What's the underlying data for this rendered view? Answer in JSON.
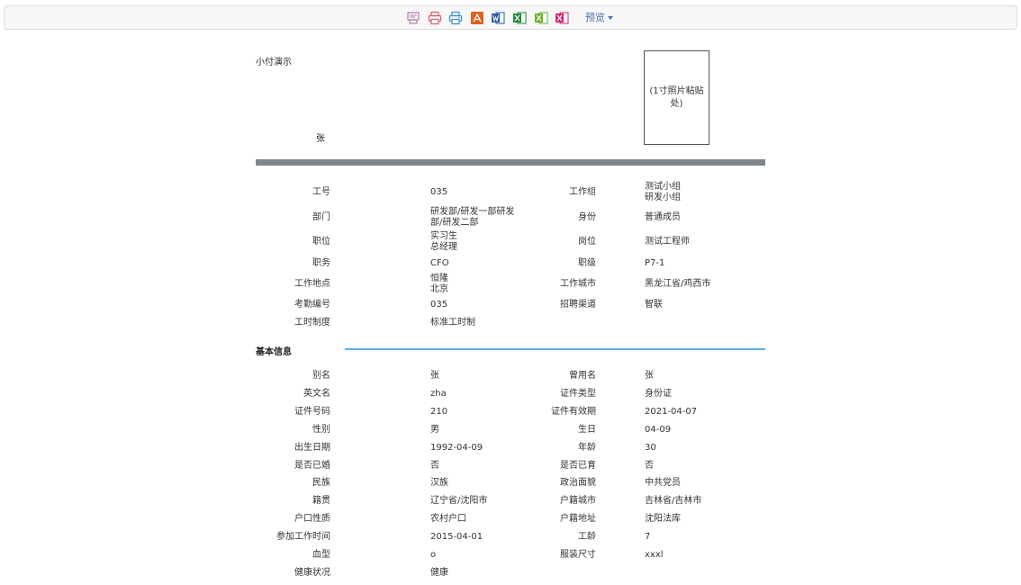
{
  "toolbar": {
    "icons": [
      {
        "name": "print-setup-icon",
        "color": "#b07fb0"
      },
      {
        "name": "print-icon",
        "color": "#e05a6a"
      },
      {
        "name": "direct-print-icon",
        "color": "#3d8fd6"
      },
      {
        "name": "pdf-export-icon",
        "color": "#e0621c"
      },
      {
        "name": "word-export-icon",
        "color": "#2a5aa8"
      },
      {
        "name": "excel-export-icon",
        "color": "#1f8a3c"
      },
      {
        "name": "excel-paged-export-icon",
        "color": "#6cae2c"
      },
      {
        "name": "excel-sheet-export-icon",
        "color": "#d6246c"
      }
    ],
    "preview_label": "预览"
  },
  "header": {
    "title": "小付演示",
    "name": "张",
    "photo_placeholder": "(1寸照片粘贴处)"
  },
  "job_info": [
    {
      "l1": "工号",
      "v1": [
        "035"
      ],
      "l2": "工作组",
      "v2": [
        "测试小组",
        "研发小组"
      ]
    },
    {
      "l1": "部门",
      "v1": [
        "研发部/研发一部研发",
        "部/研发二部"
      ],
      "l2": "身份",
      "v2": [
        "普通成员"
      ]
    },
    {
      "l1": "职位",
      "v1": [
        "实习生",
        "总经理"
      ],
      "l2": "岗位",
      "v2": [
        "测试工程师"
      ]
    },
    {
      "l1": "职务",
      "v1": [
        "CFO"
      ],
      "l2": "职级",
      "v2": [
        "P7-1"
      ]
    },
    {
      "l1": "工作地点",
      "v1": [
        "恒隆",
        "北京"
      ],
      "l2": "工作城市",
      "v2": [
        "黑龙江省/鸡西市"
      ]
    },
    {
      "l1": "考勤编号",
      "v1": [
        "035"
      ],
      "l2": "招聘渠道",
      "v2": [
        "智联"
      ]
    },
    {
      "l1": "工时制度",
      "v1": [
        "标准工时制"
      ],
      "l2": "",
      "v2": []
    }
  ],
  "basic_section_title": "基本信息",
  "basic_info": [
    {
      "l1": "别名",
      "v1": [
        "张"
      ],
      "l2": "曾用名",
      "v2": [
        "张"
      ]
    },
    {
      "l1": "英文名",
      "v1": [
        "zha"
      ],
      "l2": "证件类型",
      "v2": [
        "身份证"
      ]
    },
    {
      "l1": "证件号码",
      "v1": [
        "210"
      ],
      "l2": "证件有效期",
      "v2": [
        "2021-04-07"
      ]
    },
    {
      "l1": "性别",
      "v1": [
        "男"
      ],
      "l2": "生日",
      "v2": [
        "04-09"
      ]
    },
    {
      "l1": "出生日期",
      "v1": [
        "1992-04-09"
      ],
      "l2": "年龄",
      "v2": [
        "30"
      ]
    },
    {
      "l1": "是否已婚",
      "v1": [
        "否"
      ],
      "l2": "是否已育",
      "v2": [
        "否"
      ]
    },
    {
      "l1": "民族",
      "v1": [
        "汉族"
      ],
      "l2": "政治面貌",
      "v2": [
        "中共党员"
      ]
    },
    {
      "l1": "籍贯",
      "v1": [
        "辽宁省/沈阳市"
      ],
      "l2": "户籍城市",
      "v2": [
        "吉林省/吉林市"
      ]
    },
    {
      "l1": "户口性质",
      "v1": [
        "农村户口"
      ],
      "l2": "户籍地址",
      "v2": [
        "沈阳法库"
      ]
    },
    {
      "l1": "参加工作时间",
      "v1": [
        "2015-04-01"
      ],
      "l2": "工龄",
      "v2": [
        "7"
      ]
    },
    {
      "l1": "血型",
      "v1": [
        "o"
      ],
      "l2": "服装尺寸",
      "v2": [
        "xxxl"
      ]
    },
    {
      "l1": "健康状况",
      "v1": [
        "健康"
      ],
      "l2": "",
      "v2": []
    }
  ]
}
